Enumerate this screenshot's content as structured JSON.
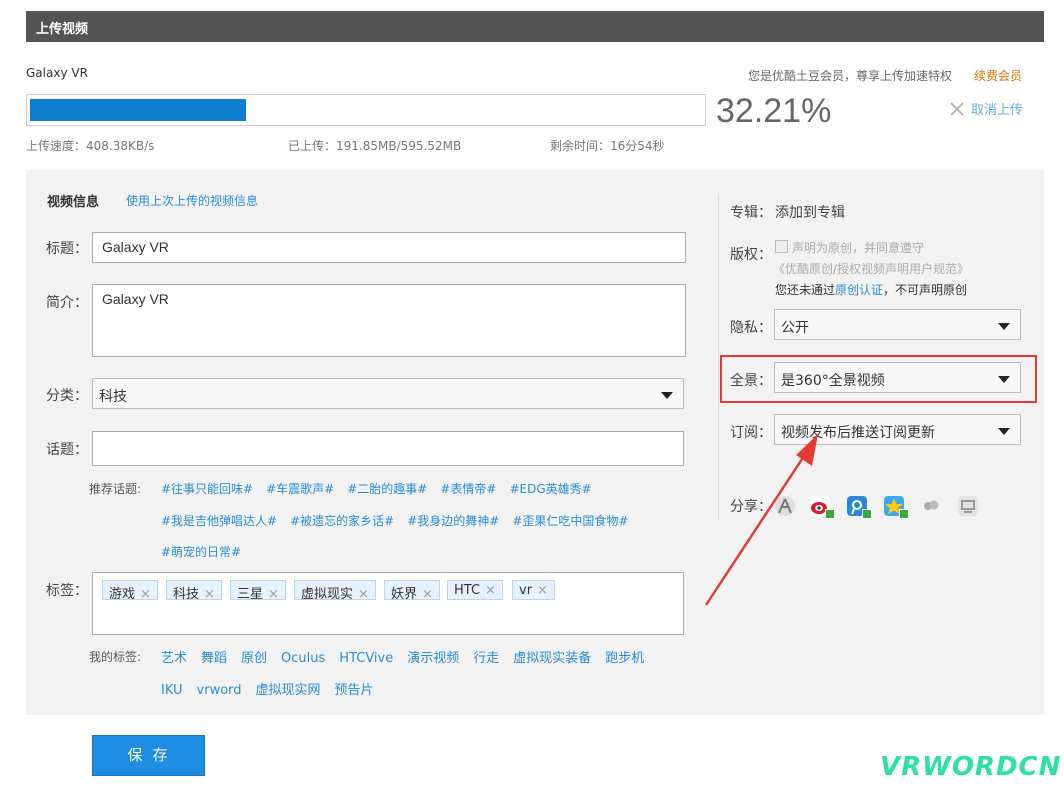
{
  "header": {
    "title": "上传视频"
  },
  "upload": {
    "filename": "Galaxy VR",
    "member_notice": "您是优酷土豆会员，尊享上传加速特权",
    "renew_link": "续费会员",
    "progress_percent": 32.21,
    "percent_text": "32.21%",
    "cancel_label": "取消上传",
    "speed": "上传速度：408.38KB/s",
    "uploaded": "已上传：191.85MB/595.52MB",
    "remaining": "剩余时间：16分54秒"
  },
  "info": {
    "section_title": "视频信息",
    "use_last_link": "使用上次上传的视频信息",
    "title_label": "标题：",
    "title_value": "Galaxy VR",
    "intro_label": "简介：",
    "intro_value": "Galaxy VR",
    "category_label": "分类：",
    "category_value": "科技",
    "topic_label": "话题：",
    "topic_value": "",
    "recommended_label": "推荐话题:",
    "recommended_topics": [
      "#往事只能回味#",
      "#车震歌声#",
      "#二胎的趣事#",
      "#表情帝#",
      "#EDG英雄秀#",
      "#我是吉他弹唱达人#",
      "#被遗忘的家乡话#",
      "#我身边的舞神#",
      "#歪果仁吃中国食物#",
      "#萌宠的日常#"
    ],
    "tags_label": "标签：",
    "tags": [
      "游戏",
      "科技",
      "三星",
      "虚拟现实",
      "妖界",
      "HTC",
      "vr"
    ],
    "tag_remove": "×",
    "my_tags_label": "我的标签:",
    "my_tags": [
      "艺术",
      "舞蹈",
      "原创",
      "Oculus",
      "HTCVive",
      "演示视频",
      "行走",
      "虚拟现实装备",
      "跑步机",
      "IKU",
      "vrword",
      "虚拟现实网",
      "预告片"
    ]
  },
  "side": {
    "album_label": "专辑：",
    "album_link": "添加到专辑",
    "copyright_label": "版权：",
    "copyright_checkbox": "声明为原创，并同意遵守",
    "copyright_terms": "《优酷原创/授权视频声明用户规范》",
    "copyright_note_pre": "您还未通过",
    "copyright_note_link": "原创认证",
    "copyright_note_post": "，不可声明原创",
    "privacy_label": "隐私：",
    "privacy_value": "公开",
    "panorama_label": "全景：",
    "panorama_value": "是360°全景视频",
    "subscribe_label": "订阅：",
    "subscribe_value": "视频发布后推送订阅更新",
    "share_label": "分享：",
    "share_icons": [
      "person-icon",
      "weibo-icon",
      "tencent-weibo-icon",
      "qzone-icon",
      "renren-icon",
      "douban-icon"
    ]
  },
  "footer": {
    "save_label": "保存",
    "watermark": "VRWORDCN"
  },
  "colors": {
    "accent": "#1e8ce0",
    "highlight": "#e53935",
    "renew": "#e07000",
    "header": "#545454"
  }
}
